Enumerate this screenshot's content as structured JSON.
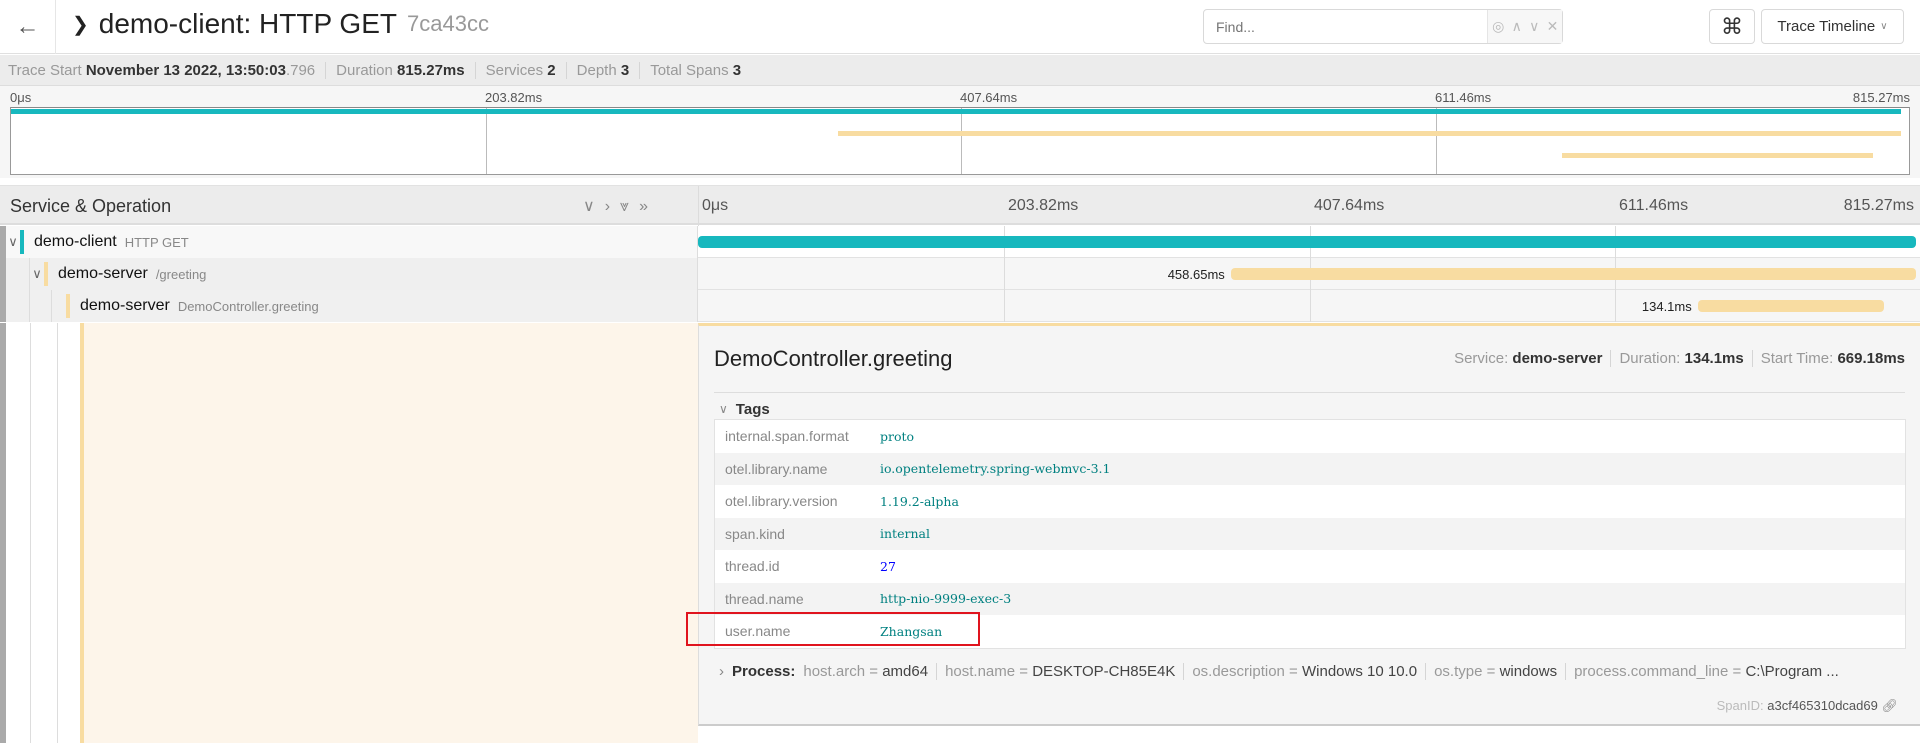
{
  "header": {
    "back_icon": "arrow-left-icon",
    "collapse_icon": "chevron-down-icon",
    "title": "demo-client: HTTP GET",
    "trace_id": "7ca43cc",
    "find_placeholder": "Find...",
    "find_controls": [
      "◎",
      "∧",
      "∨",
      "✕"
    ],
    "kbd_icon": "⌘",
    "view_select": "Trace Timeline"
  },
  "summary": [
    {
      "label": "Trace Start",
      "value": "November 13 2022, 13:50:03",
      "value_suffix": ".796"
    },
    {
      "label": "Duration",
      "value": "815.27ms"
    },
    {
      "label": "Services",
      "value": "2"
    },
    {
      "label": "Depth",
      "value": "3"
    },
    {
      "label": "Total Spans",
      "value": "3"
    }
  ],
  "ticks": [
    "0μs",
    "203.82ms",
    "407.64ms",
    "611.46ms",
    "815.27ms"
  ],
  "trace_duration_ms": 815.27,
  "colors": {
    "demo-client": "#17b8be",
    "demo-server": "#f8dca1",
    "highlight": "#e0141e"
  },
  "timeline_header": {
    "title": "Service & Operation",
    "controls": [
      "∨",
      "›",
      "⩔",
      "»"
    ]
  },
  "spans": [
    {
      "service": "demo-client",
      "operation": "HTTP GET",
      "start_ms": 0,
      "duration_ms": 815.27,
      "depth": 0,
      "label": ""
    },
    {
      "service": "demo-server",
      "operation": "/greeting",
      "start_ms": 356.62,
      "duration_ms": 458.65,
      "depth": 1,
      "label": "458.65ms"
    },
    {
      "service": "demo-server",
      "operation": "DemoController.greeting",
      "start_ms": 669.18,
      "duration_ms": 134.1,
      "depth": 2,
      "label": "134.1ms"
    }
  ],
  "detail": {
    "title": "DemoController.greeting",
    "service_label": "Service:",
    "service": "demo-server",
    "duration_label": "Duration:",
    "duration": "134.1ms",
    "start_label": "Start Time:",
    "start": "669.18ms",
    "tags_label": "Tags",
    "tags": [
      {
        "key": "internal.span.format",
        "value": "proto"
      },
      {
        "key": "otel.library.name",
        "value": "io.opentelemetry.spring-webmvc-3.1"
      },
      {
        "key": "otel.library.version",
        "value": "1.19.2-alpha"
      },
      {
        "key": "span.kind",
        "value": "internal"
      },
      {
        "key": "thread.id",
        "value": "27"
      },
      {
        "key": "thread.name",
        "value": "http-nio-9999-exec-3"
      },
      {
        "key": "user.name",
        "value": "Zhangsan"
      }
    ],
    "process_label": "Process:",
    "process": [
      {
        "key": "host.arch",
        "value": "amd64"
      },
      {
        "key": "host.name",
        "value": "DESKTOP-CH85E4K"
      },
      {
        "key": "os.description",
        "value": "Windows 10 10.0"
      },
      {
        "key": "os.type",
        "value": "windows"
      },
      {
        "key": "process.command_line",
        "value": "C:\\Program ..."
      }
    ],
    "span_id_label": "SpanID:",
    "span_id": "a3cf465310dcad69"
  }
}
